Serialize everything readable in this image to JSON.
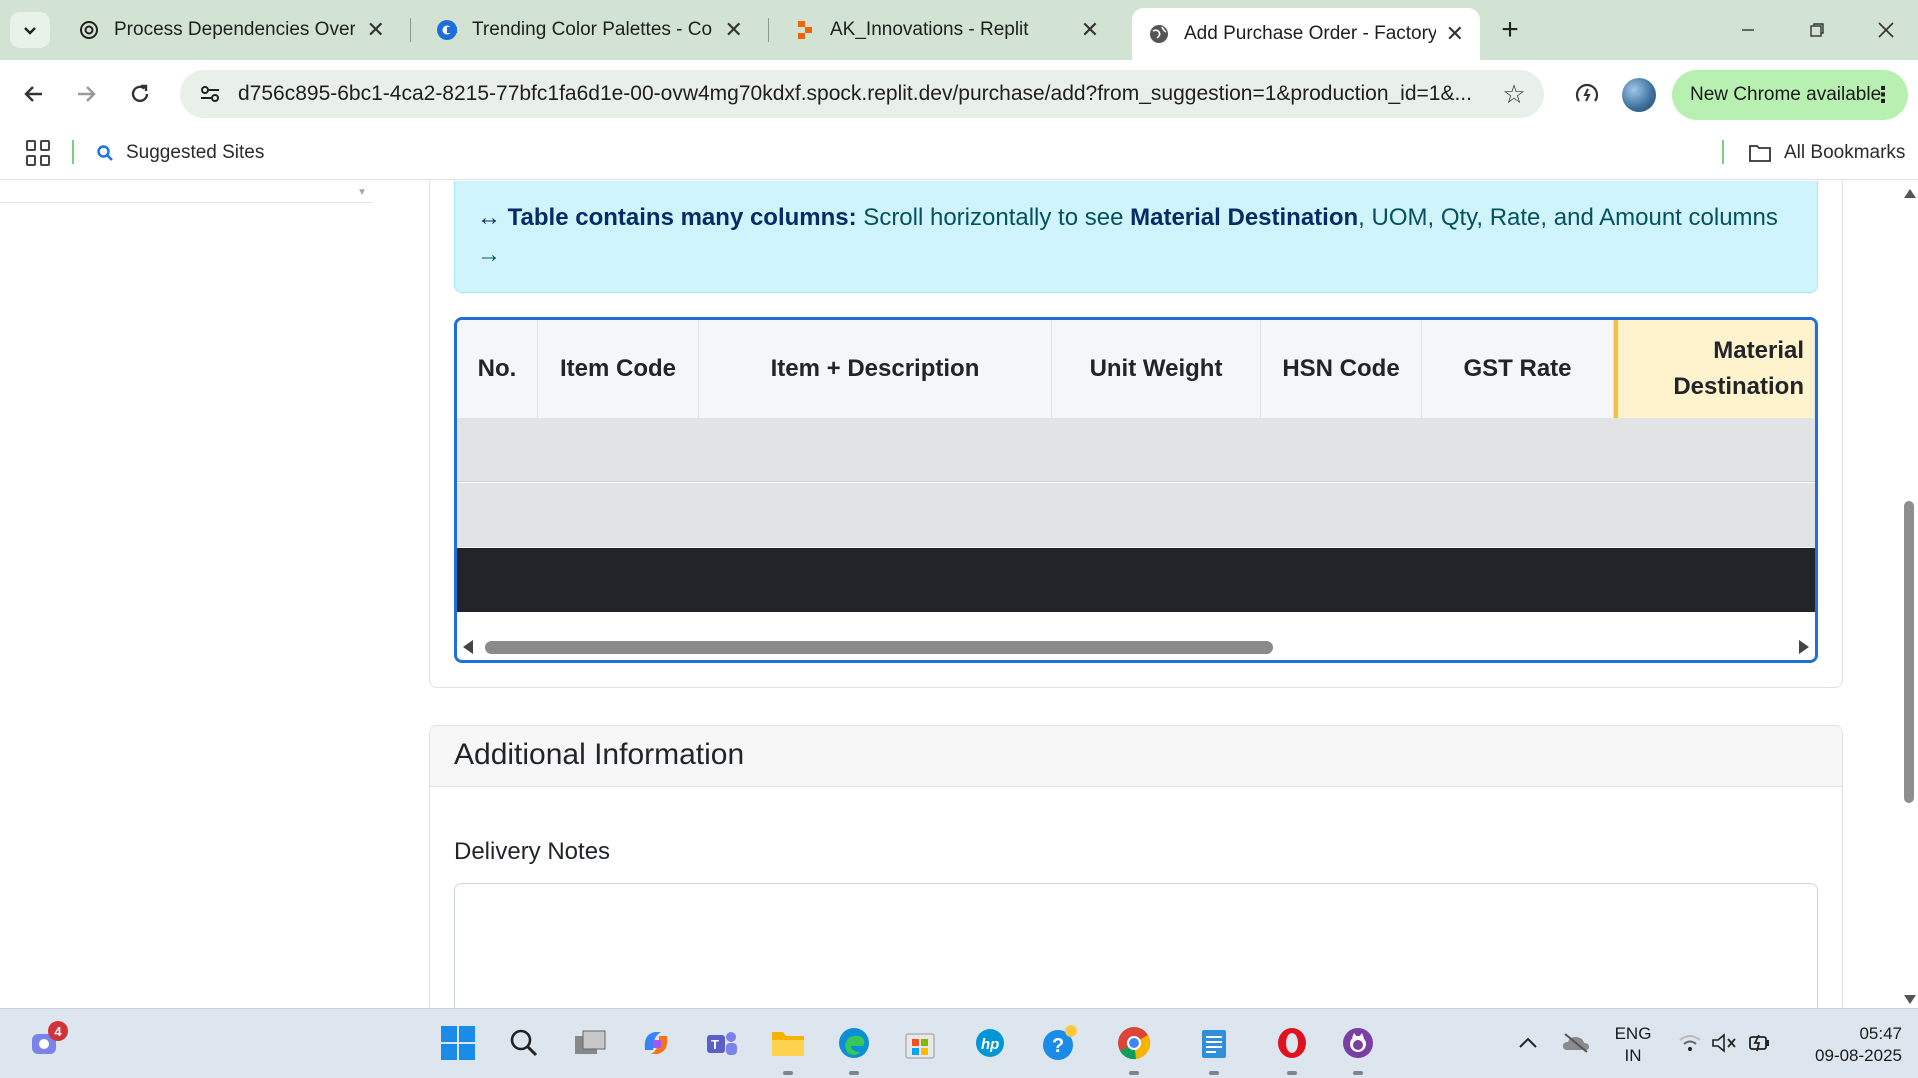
{
  "browser": {
    "tabs": [
      {
        "title": "Process Dependencies Overview",
        "active": false
      },
      {
        "title": "Trending Color Palettes - Coolors",
        "active": false
      },
      {
        "title": "AK_Innovations - Replit",
        "active": false
      },
      {
        "title": "Add Purchase Order - Factory Management",
        "active": true
      }
    ],
    "url": "d756c895-6bc1-4ca2-8215-77bfc1fa6d1e-00-ovw4mg70kdxf.spock.replit.dev/purchase/add?from_suggestion=1&production_id=1&...",
    "update_label": "New Chrome available",
    "bookmarks": {
      "suggested": "Suggested Sites",
      "all": "All Bookmarks"
    }
  },
  "page": {
    "alert": {
      "icon": "↔",
      "lead": "Table contains many columns:",
      "text_before": " Scroll horizontally to see ",
      "emphasis": "Material Destination",
      "text_after": ", UOM, Qty, Rate, and Amount columns",
      "arrow": "→"
    },
    "table": {
      "columns": [
        "No.",
        "Item Code",
        "Item + Description",
        "Unit Weight",
        "HSN Code",
        "GST Rate",
        "Material Destination"
      ],
      "highlight_column": "Material Destination",
      "rows": 3,
      "scroll_fraction_visible": 0.58
    },
    "additional_info": {
      "title": "Additional Information",
      "delivery_notes_label": "Delivery Notes",
      "delivery_notes_value": ""
    }
  },
  "taskbar": {
    "teams_badge": "4",
    "lang_line1": "ENG",
    "lang_line2": "IN",
    "time": "05:47",
    "date": "09-08-2025"
  },
  "colors": {
    "accent_border": "#1e6fd9",
    "alert_bg": "#cff4fc",
    "highlight_col": "#fff3cd",
    "update_pill": "#b7f0b0"
  }
}
